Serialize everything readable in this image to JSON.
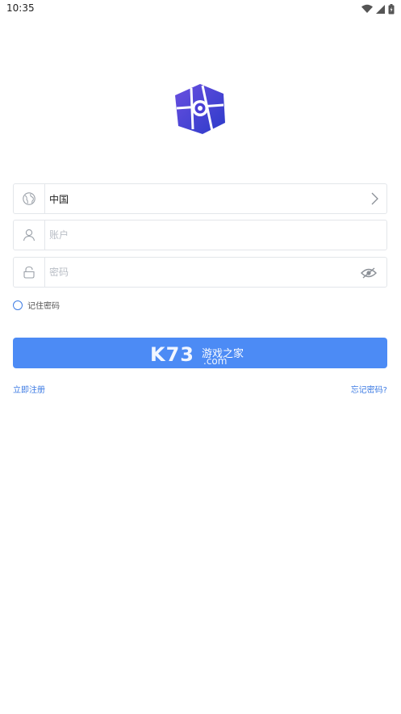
{
  "status_bar": {
    "time": "10:35"
  },
  "form": {
    "region_value": "中国",
    "account_placeholder": "账户",
    "password_placeholder": "密码",
    "remember_label": "记住密码"
  },
  "login_button": {
    "watermark_k73": "K73",
    "watermark_cn": "游戏之家",
    "watermark_com": ".com"
  },
  "links": {
    "register": "立即注册",
    "forgot": "忘记密码?"
  },
  "colors": {
    "primary": "#4c8bf5",
    "link": "#3d7be3",
    "logo": "#4a3fd6"
  },
  "icons": [
    "wifi-icon",
    "signal-icon",
    "battery-icon",
    "app-logo",
    "globe-icon",
    "chevron-right-icon",
    "user-icon",
    "lock-icon",
    "eye-slash-icon"
  ]
}
